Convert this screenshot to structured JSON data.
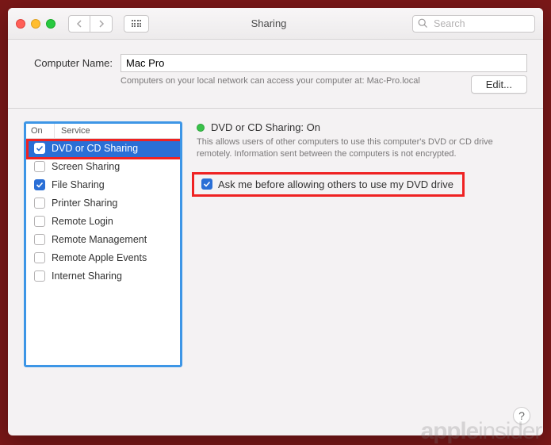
{
  "titlebar": {
    "title": "Sharing",
    "search_placeholder": "Search"
  },
  "computer_name": {
    "label": "Computer Name:",
    "value": "Mac Pro",
    "subtext": "Computers on your local network can access your computer at: Mac-Pro.local",
    "edit_label": "Edit..."
  },
  "services": {
    "col_on": "On",
    "col_service": "Service",
    "items": [
      {
        "label": "DVD or CD Sharing",
        "checked": true,
        "selected": true
      },
      {
        "label": "Screen Sharing",
        "checked": false,
        "selected": false
      },
      {
        "label": "File Sharing",
        "checked": true,
        "selected": false
      },
      {
        "label": "Printer Sharing",
        "checked": false,
        "selected": false
      },
      {
        "label": "Remote Login",
        "checked": false,
        "selected": false
      },
      {
        "label": "Remote Management",
        "checked": false,
        "selected": false
      },
      {
        "label": "Remote Apple Events",
        "checked": false,
        "selected": false
      },
      {
        "label": "Internet Sharing",
        "checked": false,
        "selected": false
      }
    ]
  },
  "detail": {
    "status_title": "DVD or CD Sharing: On",
    "status_desc": "This allows users of other computers to use this computer's DVD or CD drive remotely. Information sent between the computers is not encrypted.",
    "ask_label": "Ask me before allowing others to use my DVD drive",
    "ask_checked": true,
    "status_color": "#39c24a"
  },
  "help_label": "?",
  "watermark": "appleinsider"
}
